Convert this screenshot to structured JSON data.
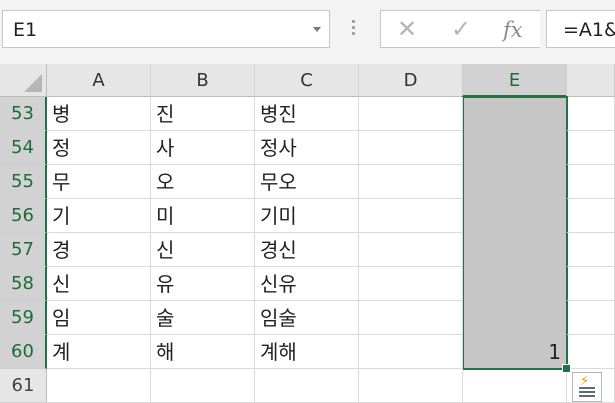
{
  "name_box": "E1",
  "formula_buttons": {
    "cancel": "✕",
    "enter": "✓",
    "fx": "fx"
  },
  "formula_bar": "=A1&",
  "columns": [
    "A",
    "B",
    "C",
    "D",
    "E"
  ],
  "selected_column": "E",
  "rows": [
    {
      "num": "53",
      "a": "병",
      "b": "진",
      "c": "병진",
      "e": ""
    },
    {
      "num": "54",
      "a": "정",
      "b": "사",
      "c": "정사",
      "e": ""
    },
    {
      "num": "55",
      "a": "무",
      "b": "오",
      "c": "무오",
      "e": ""
    },
    {
      "num": "56",
      "a": "기",
      "b": "미",
      "c": "기미",
      "e": ""
    },
    {
      "num": "57",
      "a": "경",
      "b": "신",
      "c": "경신",
      "e": ""
    },
    {
      "num": "58",
      "a": "신",
      "b": "유",
      "c": "신유",
      "e": ""
    },
    {
      "num": "59",
      "a": "임",
      "b": "술",
      "c": "임술",
      "e": ""
    },
    {
      "num": "60",
      "a": "계",
      "b": "해",
      "c": "계해",
      "e": "1"
    },
    {
      "num": "61",
      "a": "",
      "b": "",
      "c": "",
      "e": ""
    }
  ],
  "icons": {
    "quick_analysis": "quick-analysis-icon"
  },
  "colors": {
    "selection_border": "#217346",
    "selection_fill": "#c6c6c6"
  }
}
